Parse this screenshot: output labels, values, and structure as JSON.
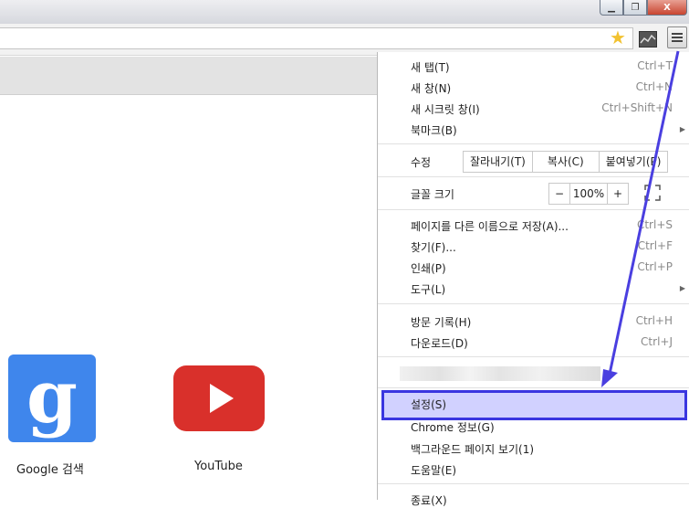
{
  "window": {
    "minimize": "▁",
    "maximize": "❐",
    "close": "X"
  },
  "tiles": [
    {
      "label": "Google 검색",
      "glyph": "g"
    },
    {
      "label": "YouTube"
    }
  ],
  "menu": {
    "new_tab": {
      "label": "새 탭(T)",
      "shortcut": "Ctrl+T"
    },
    "new_window": {
      "label": "새 창(N)",
      "shortcut": "Ctrl+N"
    },
    "new_incognito": {
      "label": "새 시크릿 창(I)",
      "shortcut": "Ctrl+Shift+N"
    },
    "bookmarks": {
      "label": "북마크(B)"
    },
    "edit": {
      "label": "수정",
      "cut": "잘라내기(T)",
      "copy": "복사(C)",
      "paste": "붙여넣기(P)"
    },
    "zoom": {
      "label": "글꼴 크기",
      "minus": "−",
      "value": "100%",
      "plus": "+"
    },
    "save_page": {
      "label": "페이지를 다른 이름으로 저장(A)...",
      "shortcut": "Ctrl+S"
    },
    "find": {
      "label": "찾기(F)...",
      "shortcut": "Ctrl+F"
    },
    "print": {
      "label": "인쇄(P)",
      "shortcut": "Ctrl+P"
    },
    "tools": {
      "label": "도구(L)"
    },
    "history": {
      "label": "방문 기록(H)",
      "shortcut": "Ctrl+H"
    },
    "downloads": {
      "label": "다운로드(D)",
      "shortcut": "Ctrl+J"
    },
    "settings": {
      "label": "설정(S)"
    },
    "about": {
      "label": "Chrome 정보(G)"
    },
    "background_pages": {
      "label": "백그라운드 페이지 보기(1)"
    },
    "help": {
      "label": "도움말(E)"
    },
    "exit": {
      "label": "종료(X)"
    }
  },
  "colors": {
    "highlight_border": "#3a36e0",
    "highlight_fill": "#d1d1ff",
    "arrow": "#4a3fe0"
  }
}
